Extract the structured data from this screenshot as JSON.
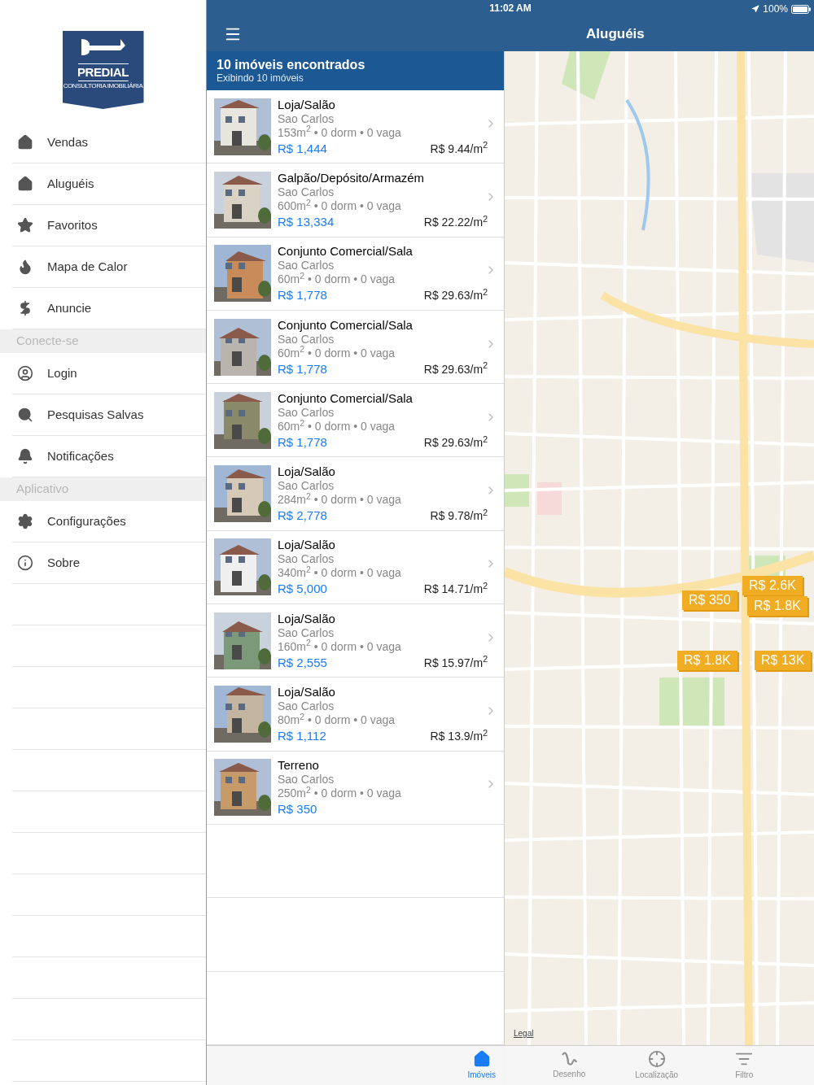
{
  "logo": {
    "name": "PREDIAL",
    "tagline": "CONSULTORIA IMOBILIÁRIA"
  },
  "sidebar": {
    "sections": [
      {
        "items": [
          {
            "label": "Vendas",
            "kind": "home"
          },
          {
            "label": "Aluguéis",
            "kind": "home"
          },
          {
            "label": "Favoritos",
            "kind": "star"
          },
          {
            "label": "Mapa de Calor",
            "kind": "flame"
          },
          {
            "label": "Anuncie",
            "kind": "dollar"
          }
        ]
      },
      {
        "title": "Conecte-se",
        "items": [
          {
            "label": "Login",
            "kind": "user"
          },
          {
            "label": "Pesquisas Salvas",
            "kind": "search"
          },
          {
            "label": "Notificações",
            "kind": "bell"
          }
        ]
      },
      {
        "title": "Aplicativo",
        "items": [
          {
            "label": "Configurações",
            "kind": "gear"
          },
          {
            "label": "Sobre",
            "kind": "info"
          }
        ]
      }
    ]
  },
  "status_bar": {
    "time": "11:02 AM",
    "battery": "100%"
  },
  "nav_bar": {
    "title": "Aluguéis"
  },
  "results": {
    "count": "10 imóveis encontrados",
    "showing": "Exibindo 10 imóveis"
  },
  "listings": [
    {
      "type": "Loja/Salão",
      "city": "Sao Carlos",
      "details": "153m$^{2}$ • 0 dorm • 0 vaga",
      "price": "R$ 1,444",
      "price_per_m2": "R$ 9.44/m$^{2}$"
    },
    {
      "type": "Galpão/Depósito/Armazém",
      "city": "Sao Carlos",
      "details": "600m$^{2}$ • 0 dorm • 0 vaga",
      "price": "R$ 13,334",
      "price_per_m2": "R$ 22.22/m$^{2}$"
    },
    {
      "type": "Conjunto Comercial/Sala",
      "city": "Sao Carlos",
      "details": "60m$^{2}$ • 0 dorm • 0 vaga",
      "price": "R$ 1,778",
      "price_per_m2": "R$ 29.63/m$^{2}$"
    },
    {
      "type": "Conjunto Comercial/Sala",
      "city": "Sao Carlos",
      "details": "60m$^{2}$ • 0 dorm • 0 vaga",
      "price": "R$ 1,778",
      "price_per_m2": "R$ 29.63/m$^{2}$"
    },
    {
      "type": "Conjunto Comercial/Sala",
      "city": "Sao Carlos",
      "details": "60m$^{2}$ • 0 dorm • 0 vaga",
      "price": "R$ 1,778",
      "price_per_m2": "R$ 29.63/m$^{2}$"
    },
    {
      "type": "Loja/Salão",
      "city": "Sao Carlos",
      "details": "284m$^{2}$ • 0 dorm • 0 vaga",
      "price": "R$ 2,778",
      "price_per_m2": "R$ 9.78/m$^{2}$"
    },
    {
      "type": "Loja/Salão",
      "city": "Sao Carlos",
      "details": "340m$^{2}$ • 0 dorm • 0 vaga",
      "price": "R$ 5,000",
      "price_per_m2": "R$ 14.71/m$^{2}$"
    },
    {
      "type": "Loja/Salão",
      "city": "Sao Carlos",
      "details": "160m$^{2}$ • 0 dorm • 0 vaga",
      "price": "R$ 2,555",
      "price_per_m2": "R$ 15.97/m$^{2}$"
    },
    {
      "type": "Loja/Salão",
      "city": "Sao Carlos",
      "details": "80m$^{2}$ • 0 dorm • 0 vaga",
      "price": "R$ 1,112",
      "price_per_m2": "R$ 13.9/m$^{2}$"
    },
    {
      "type": "Terreno",
      "city": "Sao Carlos",
      "details": "250m$^{2}$ • 0 dorm • 0 vaga",
      "price": "R$ 350"
    }
  ],
  "map": {
    "markers": [
      "R$ 2.6K",
      "R$ 350",
      "R$ 1.8K",
      "R$ 1.8K",
      "R$ 13K"
    ],
    "legal": "Legal"
  },
  "tab_bar": [
    {
      "label": "Imóveis",
      "kind": "home",
      "selected": true
    },
    {
      "label": "Desenho",
      "kind": "squiggle",
      "selected": false
    },
    {
      "label": "Localização",
      "kind": "locate",
      "selected": false
    },
    {
      "label": "Filtro",
      "kind": "filter",
      "selected": false
    }
  ]
}
